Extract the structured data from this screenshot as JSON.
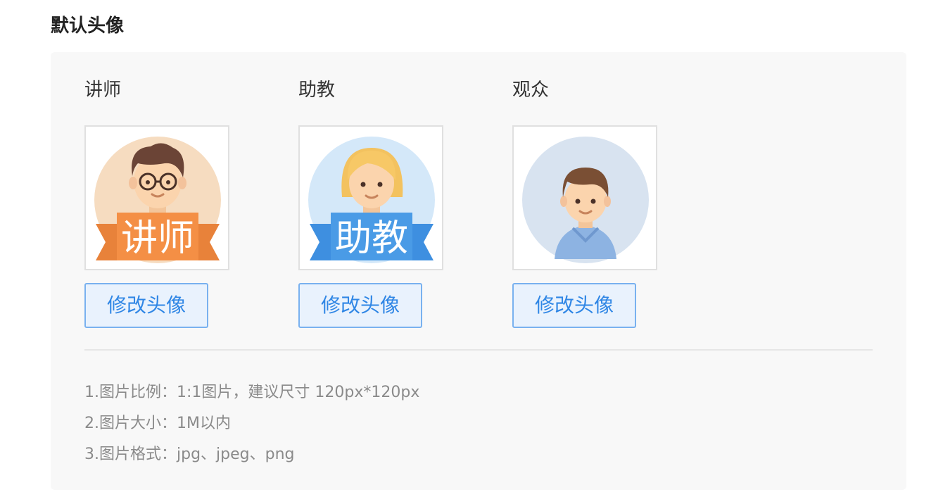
{
  "section": {
    "title": "默认头像"
  },
  "avatars": [
    {
      "role": "讲师",
      "banner": "讲师",
      "button": "修改头像",
      "icon": "lecturer-avatar-icon"
    },
    {
      "role": "助教",
      "banner": "助教",
      "button": "修改头像",
      "icon": "assistant-avatar-icon"
    },
    {
      "role": "观众",
      "banner": "",
      "button": "修改头像",
      "icon": "audience-avatar-icon"
    }
  ],
  "notes": [
    "1.图片比例：1:1图片，建议尺寸 120px*120px",
    "2.图片大小：1M以内",
    "3.图片格式：jpg、jpeg、png"
  ],
  "colors": {
    "lecturer_circle": "#f6dcc0",
    "lecturer_banner": "#e8823a",
    "assistant_circle": "#d4e8f9",
    "assistant_banner": "#3e8fe0",
    "audience_circle": "#d8e3f0",
    "button_text": "#2f86e5",
    "button_border": "#79b1ef"
  }
}
